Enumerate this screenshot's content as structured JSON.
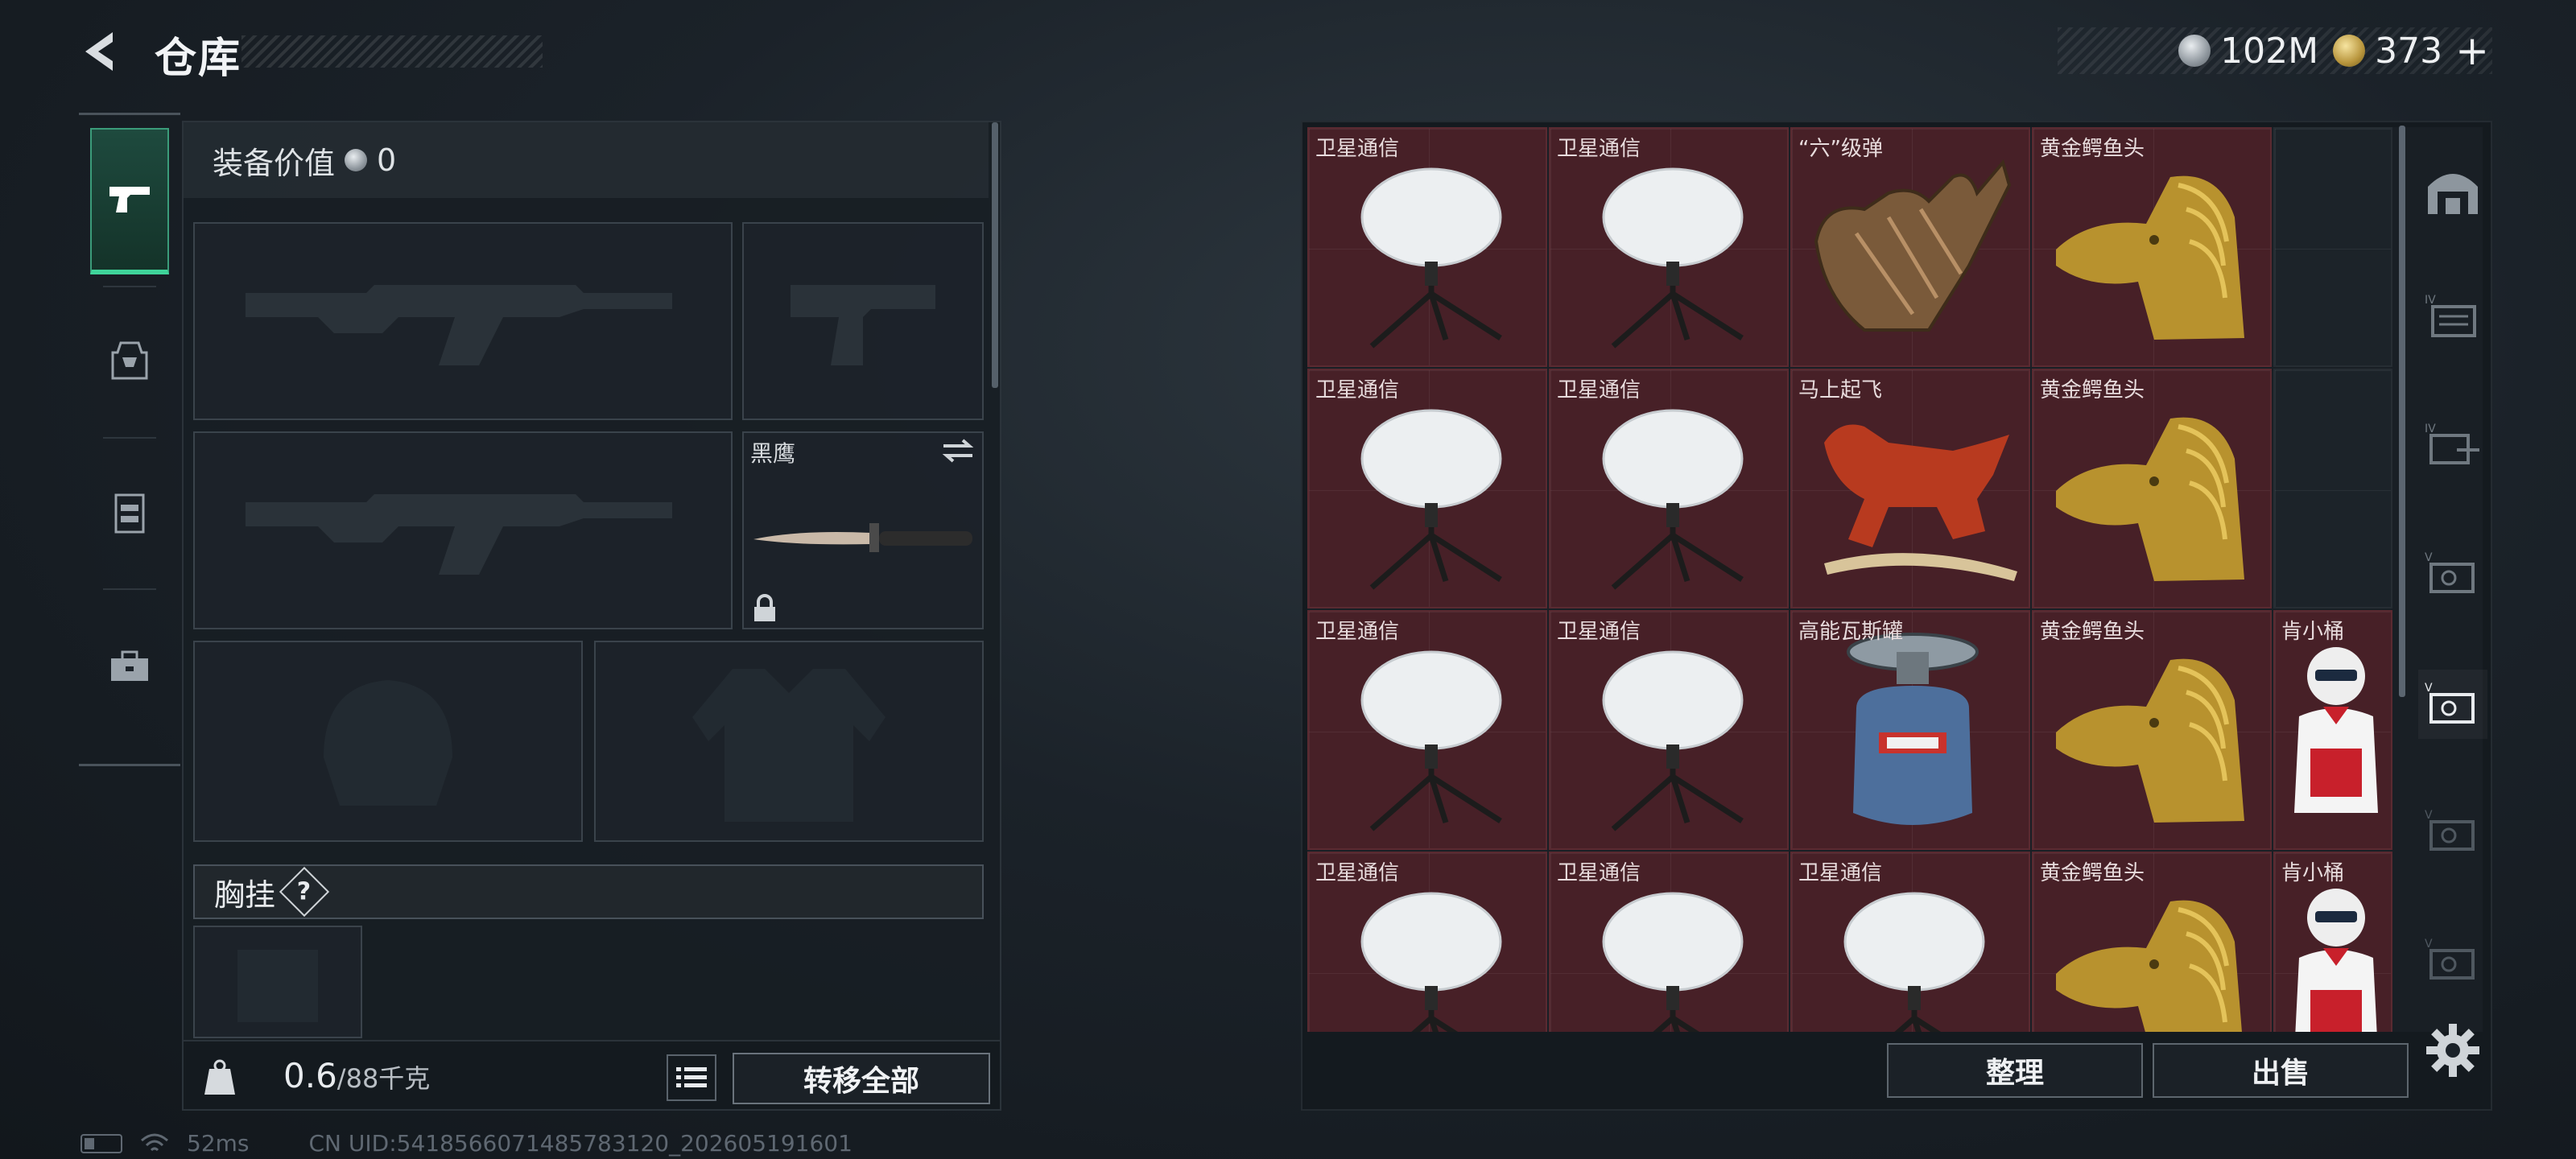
{
  "header": {
    "title": "仓库"
  },
  "currency": {
    "silver": "102M",
    "gold": "373",
    "plus": "+"
  },
  "equipment": {
    "value_label": "装备价值",
    "value": "0",
    "knife_label": "黑鹰",
    "chest_label": "胸挂",
    "help": "?"
  },
  "weight": {
    "current": "0.6",
    "max": "/88千克"
  },
  "buttons": {
    "transfer_all": "转移全部",
    "sort": "整理",
    "sell": "出售"
  },
  "status": {
    "ping": "52ms",
    "uid": "CN UID:5418566071485783120_202605191601"
  },
  "storage": {
    "rows": [
      [
        "卫星通信",
        "卫星通信",
        "“六”级弹",
        "黄金鳄鱼头",
        ""
      ],
      [
        "卫星通信",
        "卫星通信",
        "马上起飞",
        "黄金鳄鱼头",
        ""
      ],
      [
        "卫星通信",
        "卫星通信",
        "高能瓦斯罐",
        "黄金鳄鱼头",
        "肯小桶"
      ],
      [
        "卫星通信",
        "卫星通信",
        "卫星通信",
        "黄金鳄鱼头",
        "肯小桶"
      ]
    ]
  },
  "colors": {
    "accent": "#3fd49a",
    "cell": "#472027",
    "panel": "#141a1f"
  }
}
